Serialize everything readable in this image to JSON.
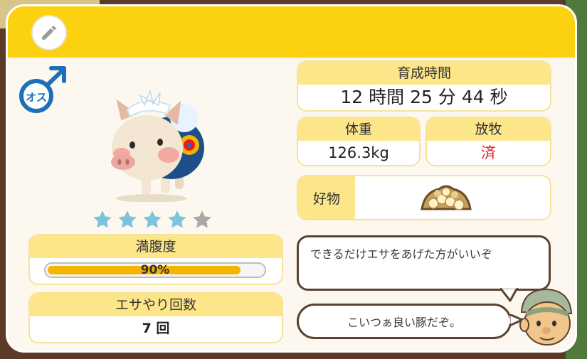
{
  "header": {
    "edit_icon": "pencil-icon"
  },
  "pet": {
    "gender_label": "オス",
    "gender_icon": "male-icon",
    "stars_total": 5,
    "stars_filled": 4,
    "star_color": "#7cc3dd",
    "star_empty_color": "#a9a9a9"
  },
  "stats": {
    "growth_time_label": "育成時間",
    "growth_time_value": "12 時間 25 分 44 秒",
    "weight_label": "体重",
    "weight_value": "126.3kg",
    "graze_label": "放牧",
    "graze_value": "済",
    "graze_value_color": "#e31b23",
    "favorite_label": "好物",
    "favorite_icon": "peanuts-icon"
  },
  "fullness": {
    "label": "満腹度",
    "value_text": "90%",
    "value": 0.9
  },
  "feed": {
    "label": "エサやり回数",
    "count_text": "7 回"
  },
  "speech": {
    "advice_text": "できるだけエサをあげた方がいいぞ",
    "comment_text": "こいつぁ良い豚だぞ。"
  },
  "colors": {
    "accent": "#fcd10f",
    "label_bg": "#fde68a",
    "gauge_fill": "#f4b400"
  }
}
